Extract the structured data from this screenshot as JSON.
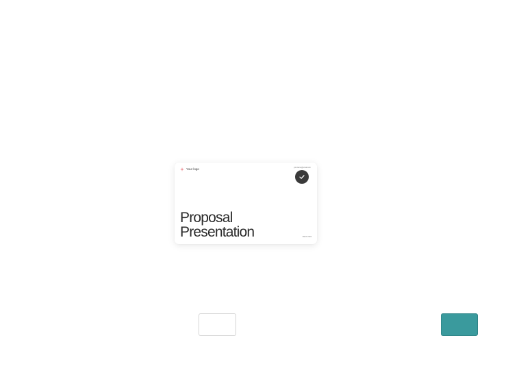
{
  "template_card": {
    "logo_text": "Your logo",
    "email": "yourname@email.com",
    "title_line1": "Proposal",
    "title_line2": "Presentation",
    "date": "March 2024",
    "selected": true,
    "logo_color": "#e8737a",
    "badge_color": "#3a3a3a"
  },
  "footer": {
    "secondary_button_label": "",
    "primary_button_label": "",
    "primary_color": "#3a9a9d"
  }
}
